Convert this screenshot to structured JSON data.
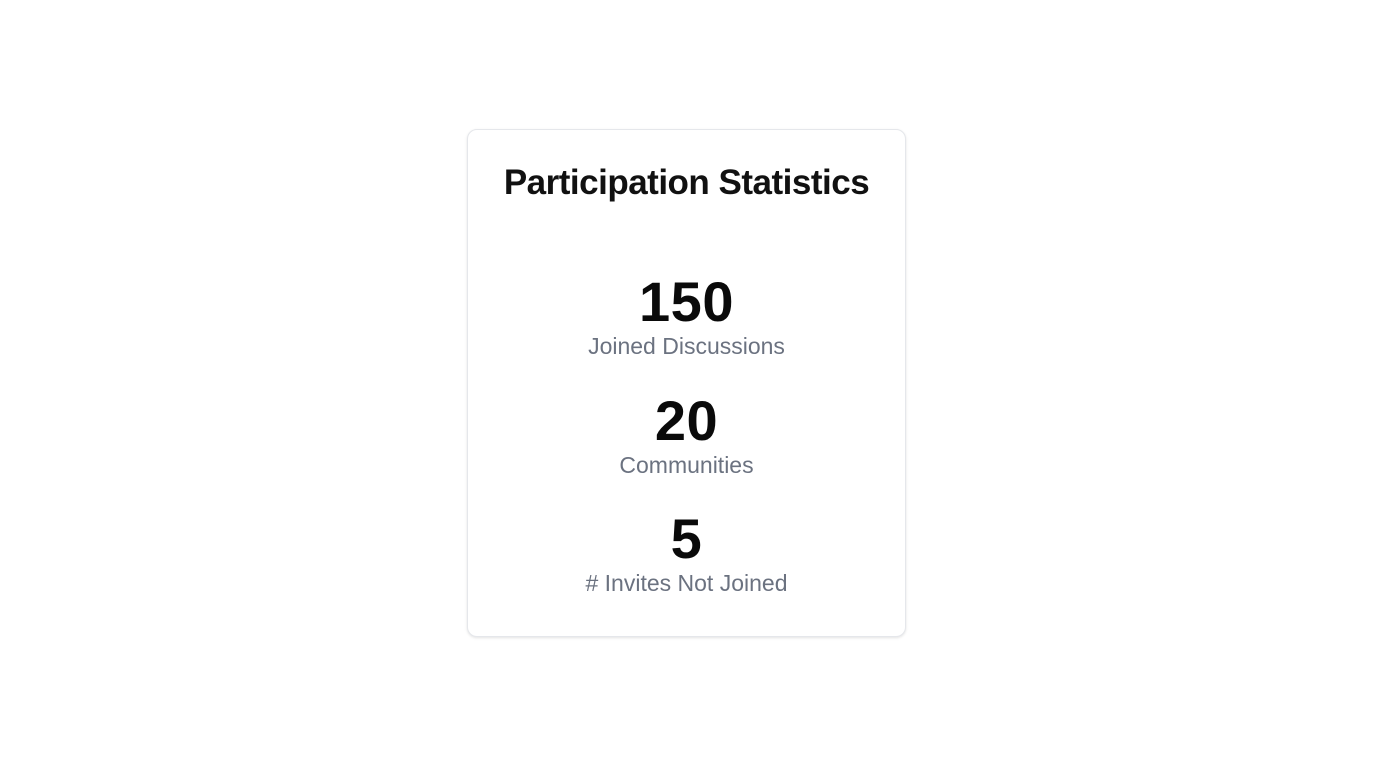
{
  "card": {
    "title": "Participation Statistics",
    "stats": [
      {
        "value": "150",
        "label": "Joined Discussions"
      },
      {
        "value": "20",
        "label": "Communities"
      },
      {
        "value": "5",
        "label": "# Invites Not Joined"
      }
    ]
  },
  "colors": {
    "background": "#ffffff",
    "card_border": "#e5e7eb",
    "value_text": "#0a0a0a",
    "label_text": "#6b7280"
  }
}
